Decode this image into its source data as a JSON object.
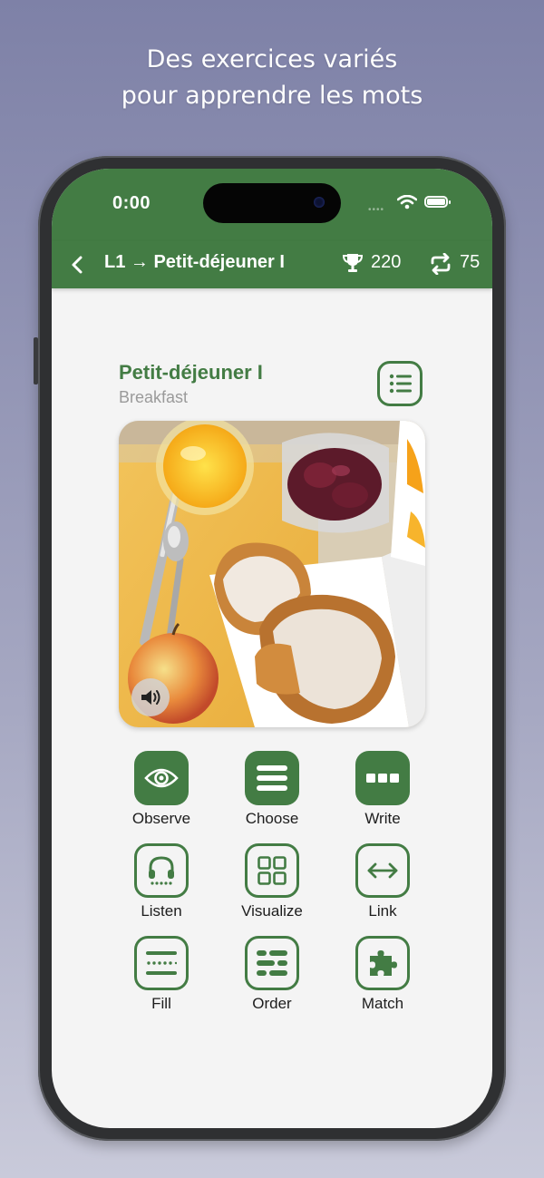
{
  "promo": {
    "line1": "Des exercices variés",
    "line2": "pour apprendre les mots"
  },
  "status_bar": {
    "time": "0:00"
  },
  "nav": {
    "title": "L1 → Petit-déjeuner I",
    "score": "220",
    "repeat_count": "75"
  },
  "lesson": {
    "title": "Petit-déjeuner I",
    "subtitle": "Breakfast"
  },
  "exercises": [
    {
      "label": "Observe",
      "icon": "eye-icon",
      "style": "filled"
    },
    {
      "label": "Choose",
      "icon": "menu-lines-icon",
      "style": "filled"
    },
    {
      "label": "Write",
      "icon": "keyboard-dots-icon",
      "style": "filled"
    },
    {
      "label": "Listen",
      "icon": "headphones-icon",
      "style": "outline"
    },
    {
      "label": "Visualize",
      "icon": "grid-icon",
      "style": "outline"
    },
    {
      "label": "Link",
      "icon": "arrows-horizontal-icon",
      "style": "outline"
    },
    {
      "label": "Fill",
      "icon": "fill-blank-icon",
      "style": "outline"
    },
    {
      "label": "Order",
      "icon": "order-lines-icon",
      "style": "outline"
    },
    {
      "label": "Match",
      "icon": "puzzle-icon",
      "style": "outline"
    }
  ],
  "colors": {
    "accent": "#437c44",
    "background": "#f4f4f4",
    "subtitle": "#9a9a9a"
  }
}
